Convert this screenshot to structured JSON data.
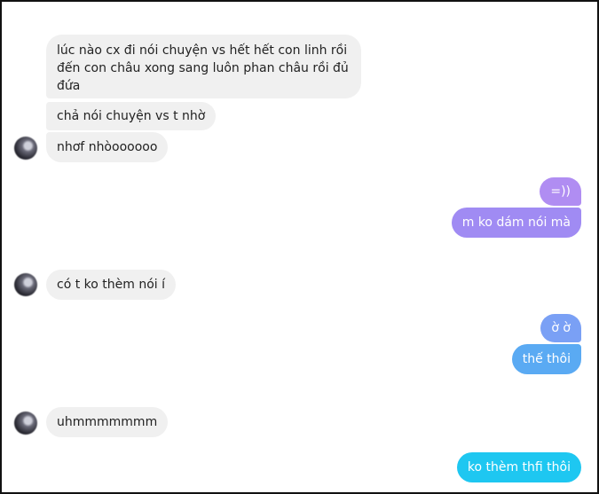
{
  "messages": {
    "m1": "lúc nào cx đi nói chuyện vs hết hết con linh rồi",
    "m1b": "đến con châu xong sang luôn phan châu rồi đủ",
    "m1c": "đứa",
    "m2": "chả nói chuyện vs t nhờ",
    "m3": "nhơf nhòoooooo",
    "m4": "=))",
    "m5": "m ko dám nói mà",
    "m6": "có t ko thèm nói í",
    "m7": "ờ ờ",
    "m8": "thế thôi",
    "m9": "uhmmmmmmm",
    "m10": "ko thèm thfi thôi"
  },
  "colors": {
    "incoming": "#f0f0f0",
    "outgoing_purple": "#a98cf0",
    "outgoing_blue": "#6aa3f3",
    "outgoing_cyan": "#1ec7f1"
  },
  "icons": {
    "avatar": "contact-avatar"
  }
}
